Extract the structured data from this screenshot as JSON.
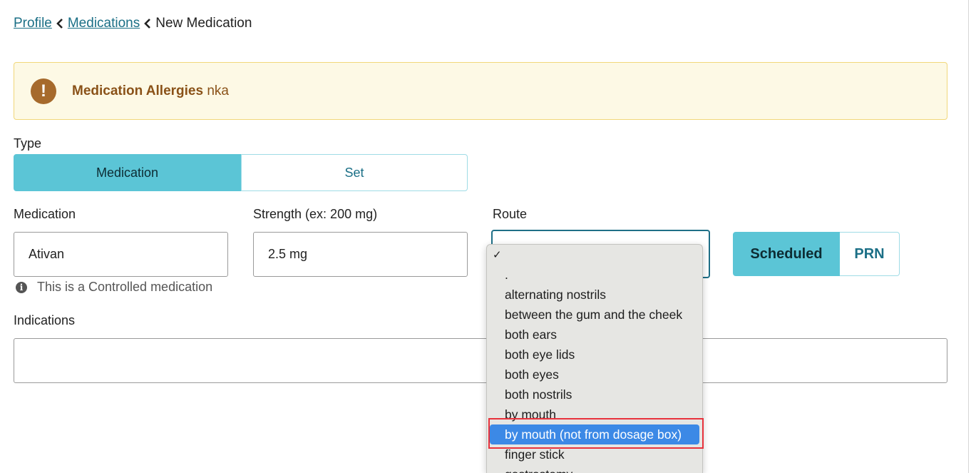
{
  "breadcrumb": {
    "items": [
      "Profile",
      "Medications"
    ],
    "current": "New Medication"
  },
  "alert": {
    "title": "Medication Allergies",
    "value": "nka",
    "icon": "exclamation-icon"
  },
  "type": {
    "label": "Type",
    "options": [
      "Medication",
      "Set"
    ],
    "selected": "Medication"
  },
  "medication": {
    "label": "Medication",
    "value": "Ativan",
    "note": "This is a Controlled medication"
  },
  "strength": {
    "label": "Strength (ex: 200 mg)",
    "value": "2.5 mg"
  },
  "route": {
    "label": "Route",
    "value": "",
    "check_mark": "✓",
    "options": [
      ".",
      "alternating nostrils",
      "between the gum and the cheek",
      "both ears",
      "both eye lids",
      "both eyes",
      "both nostrils",
      "by mouth",
      "by mouth (not from dosage box)",
      "finger stick",
      "gastrostomy"
    ],
    "highlighted": "by mouth (not from dosage box)"
  },
  "schedule": {
    "options": [
      "Scheduled",
      "PRN"
    ],
    "selected": "Scheduled"
  },
  "indications": {
    "label": "Indications",
    "value": ""
  },
  "colors": {
    "accent": "#5bc5d6",
    "link": "#1b6f86",
    "alert_bg": "#fdf9e5",
    "alert_text": "#8a5218",
    "menu_select": "#3c89e6",
    "annotation_box": "#e8323c"
  }
}
